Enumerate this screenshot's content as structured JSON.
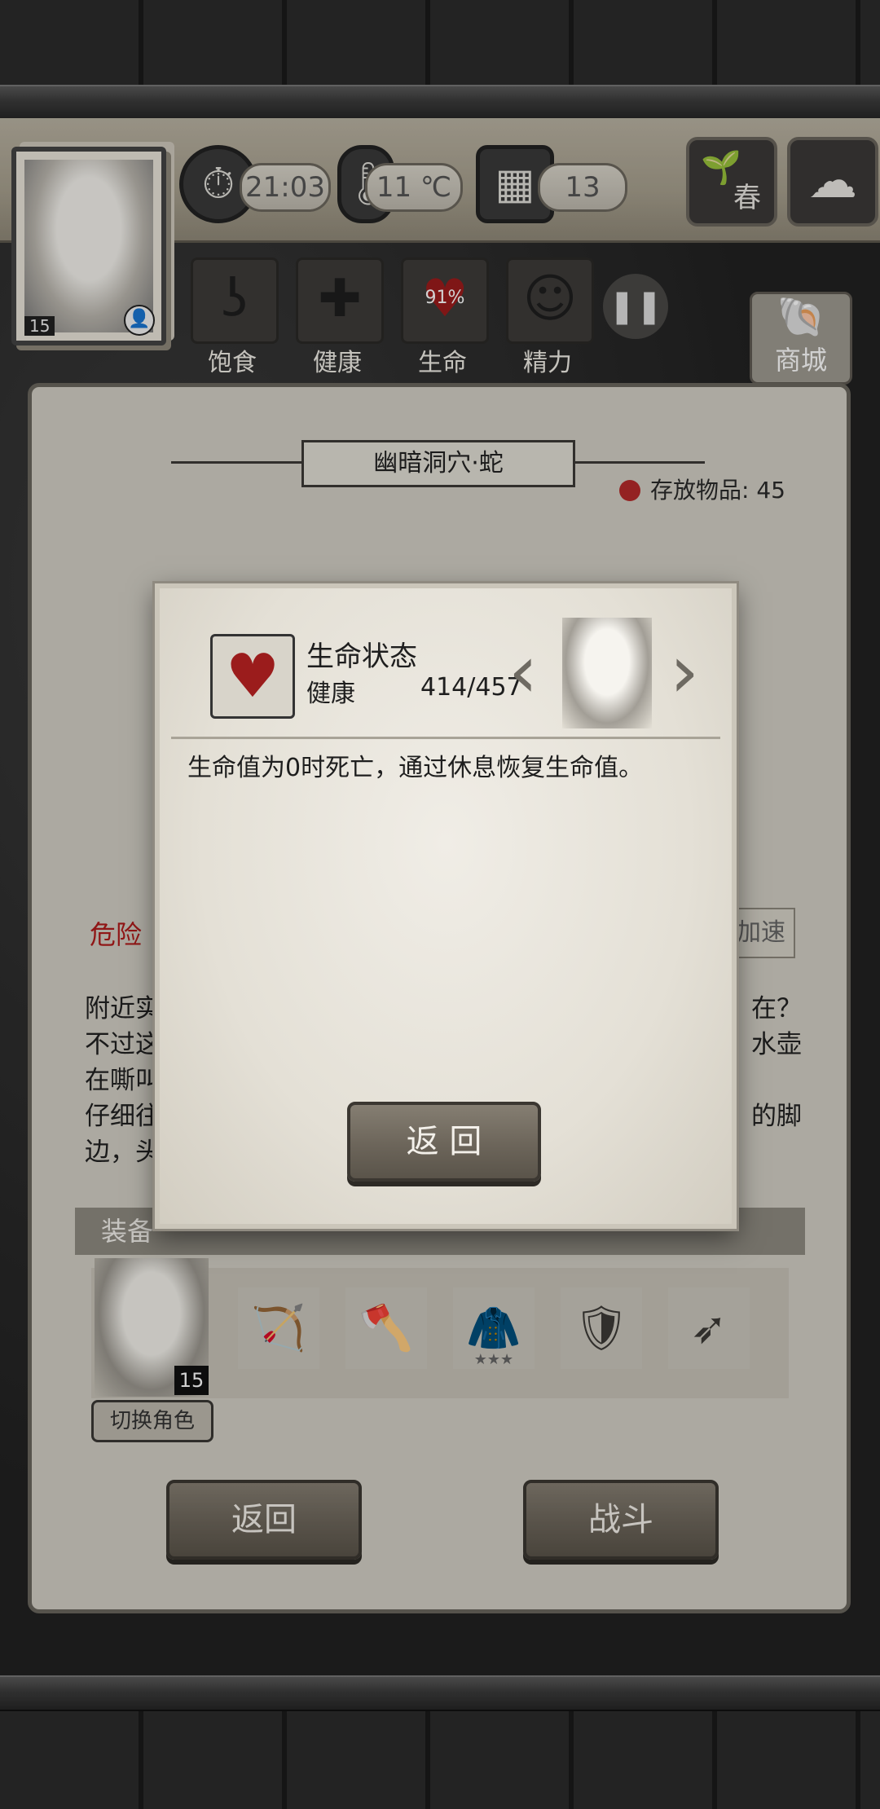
{
  "hud": {
    "time": "21:03",
    "temperature": "11 ℃",
    "day": "13",
    "season": "春",
    "player_level": "15"
  },
  "stats": {
    "hunger_label": "饱食",
    "health_label": "健康",
    "life_label": "生命",
    "life_percent": "91%",
    "energy_label": "精力"
  },
  "shop": {
    "label": "商城"
  },
  "location": {
    "title": "幽暗洞穴·蛇",
    "storage_label": "存放物品: 45"
  },
  "event": {
    "danger_label": "危险",
    "speed_label": "加速",
    "story_lines": [
      "附近实",
      "不过这",
      "在嘶叫",
      "仔细往",
      "边，头"
    ],
    "story_right": [
      "在？",
      "水壶",
      "",
      "的脚",
      ""
    ]
  },
  "equipment": {
    "section_label": "装备",
    "char_level": "15",
    "switch_label": "切换角色",
    "slots": [
      {
        "icon": "crossbow-icon",
        "glyph": "🏹",
        "stars": ""
      },
      {
        "icon": "axe-icon",
        "glyph": "🪓",
        "stars": ""
      },
      {
        "icon": "cloak-icon",
        "glyph": "🧥",
        "stars": "★★★"
      },
      {
        "icon": "shield-icon",
        "glyph": "🛡",
        "stars": ""
      },
      {
        "icon": "arrows-icon",
        "glyph": "➶",
        "stars": ""
      }
    ]
  },
  "buttons": {
    "back": "返回",
    "fight": "战斗"
  },
  "modal": {
    "title": "生命状态",
    "stat_label": "健康",
    "stat_value": "414/457",
    "description": "生命值为0时死亡，通过休息恢复生命值。",
    "return_label": "返 回"
  }
}
